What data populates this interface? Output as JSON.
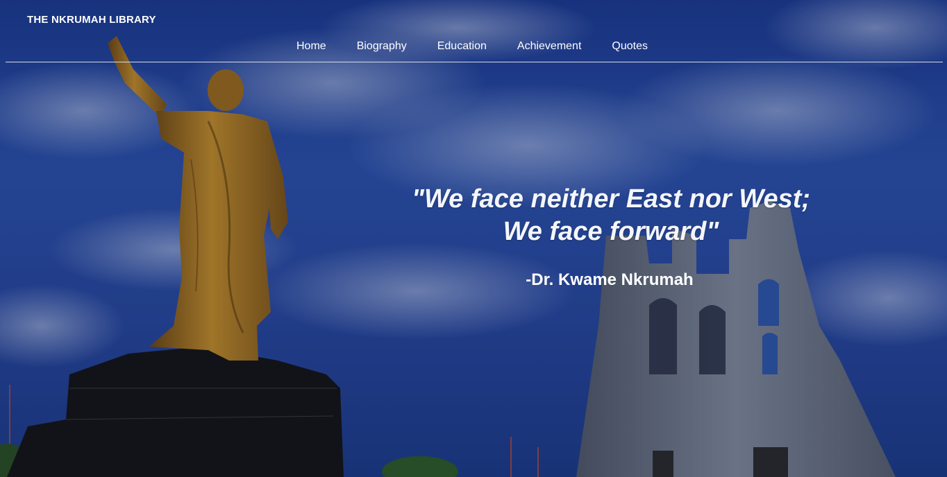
{
  "brand": {
    "title": "THE NKRUMAH LIBRARY"
  },
  "nav": {
    "items": [
      {
        "label": "Home"
      },
      {
        "label": "Biography"
      },
      {
        "label": "Education"
      },
      {
        "label": "Achievement"
      },
      {
        "label": "Quotes"
      }
    ]
  },
  "hero": {
    "quote_line1": "\"We face neither East nor West;",
    "quote_line2": "We face forward\"",
    "author": "-Dr. Kwame Nkrumah",
    "image_subject": "kwame-nkrumah-statue-and-mausoleum",
    "colors": {
      "sky": "#2a50a8",
      "statue": "#b07a1e",
      "pedestal": "#141414",
      "mausoleum": "#6c7584"
    }
  }
}
